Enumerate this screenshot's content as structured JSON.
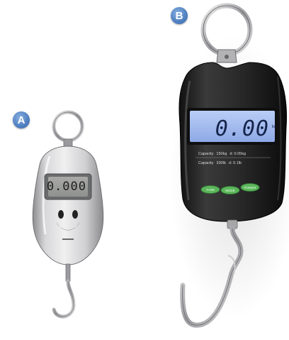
{
  "labels": {
    "a": "A",
    "b": "B"
  },
  "scale_a": {
    "display": "0.000"
  },
  "scale_b": {
    "display": "0.00",
    "unit": "kg",
    "capacity_rows": [
      {
        "label": "Capacity",
        "max": "150kg",
        "division": "d: 0.05kg"
      },
      {
        "label": "Capacity",
        "max": "330lb",
        "division": "d: 0.1lb"
      }
    ],
    "buttons": [
      "TARE",
      "MODE",
      "POWER"
    ]
  },
  "colors": {
    "badge_blue": "#4f7fc0",
    "scale_a_body": "#c8c8ca",
    "scale_b_body": "#1f1f1f",
    "scale_b_lcd": "#9fb8f0",
    "button_green": "#5bb55a",
    "metal": "#a9a9ab"
  }
}
